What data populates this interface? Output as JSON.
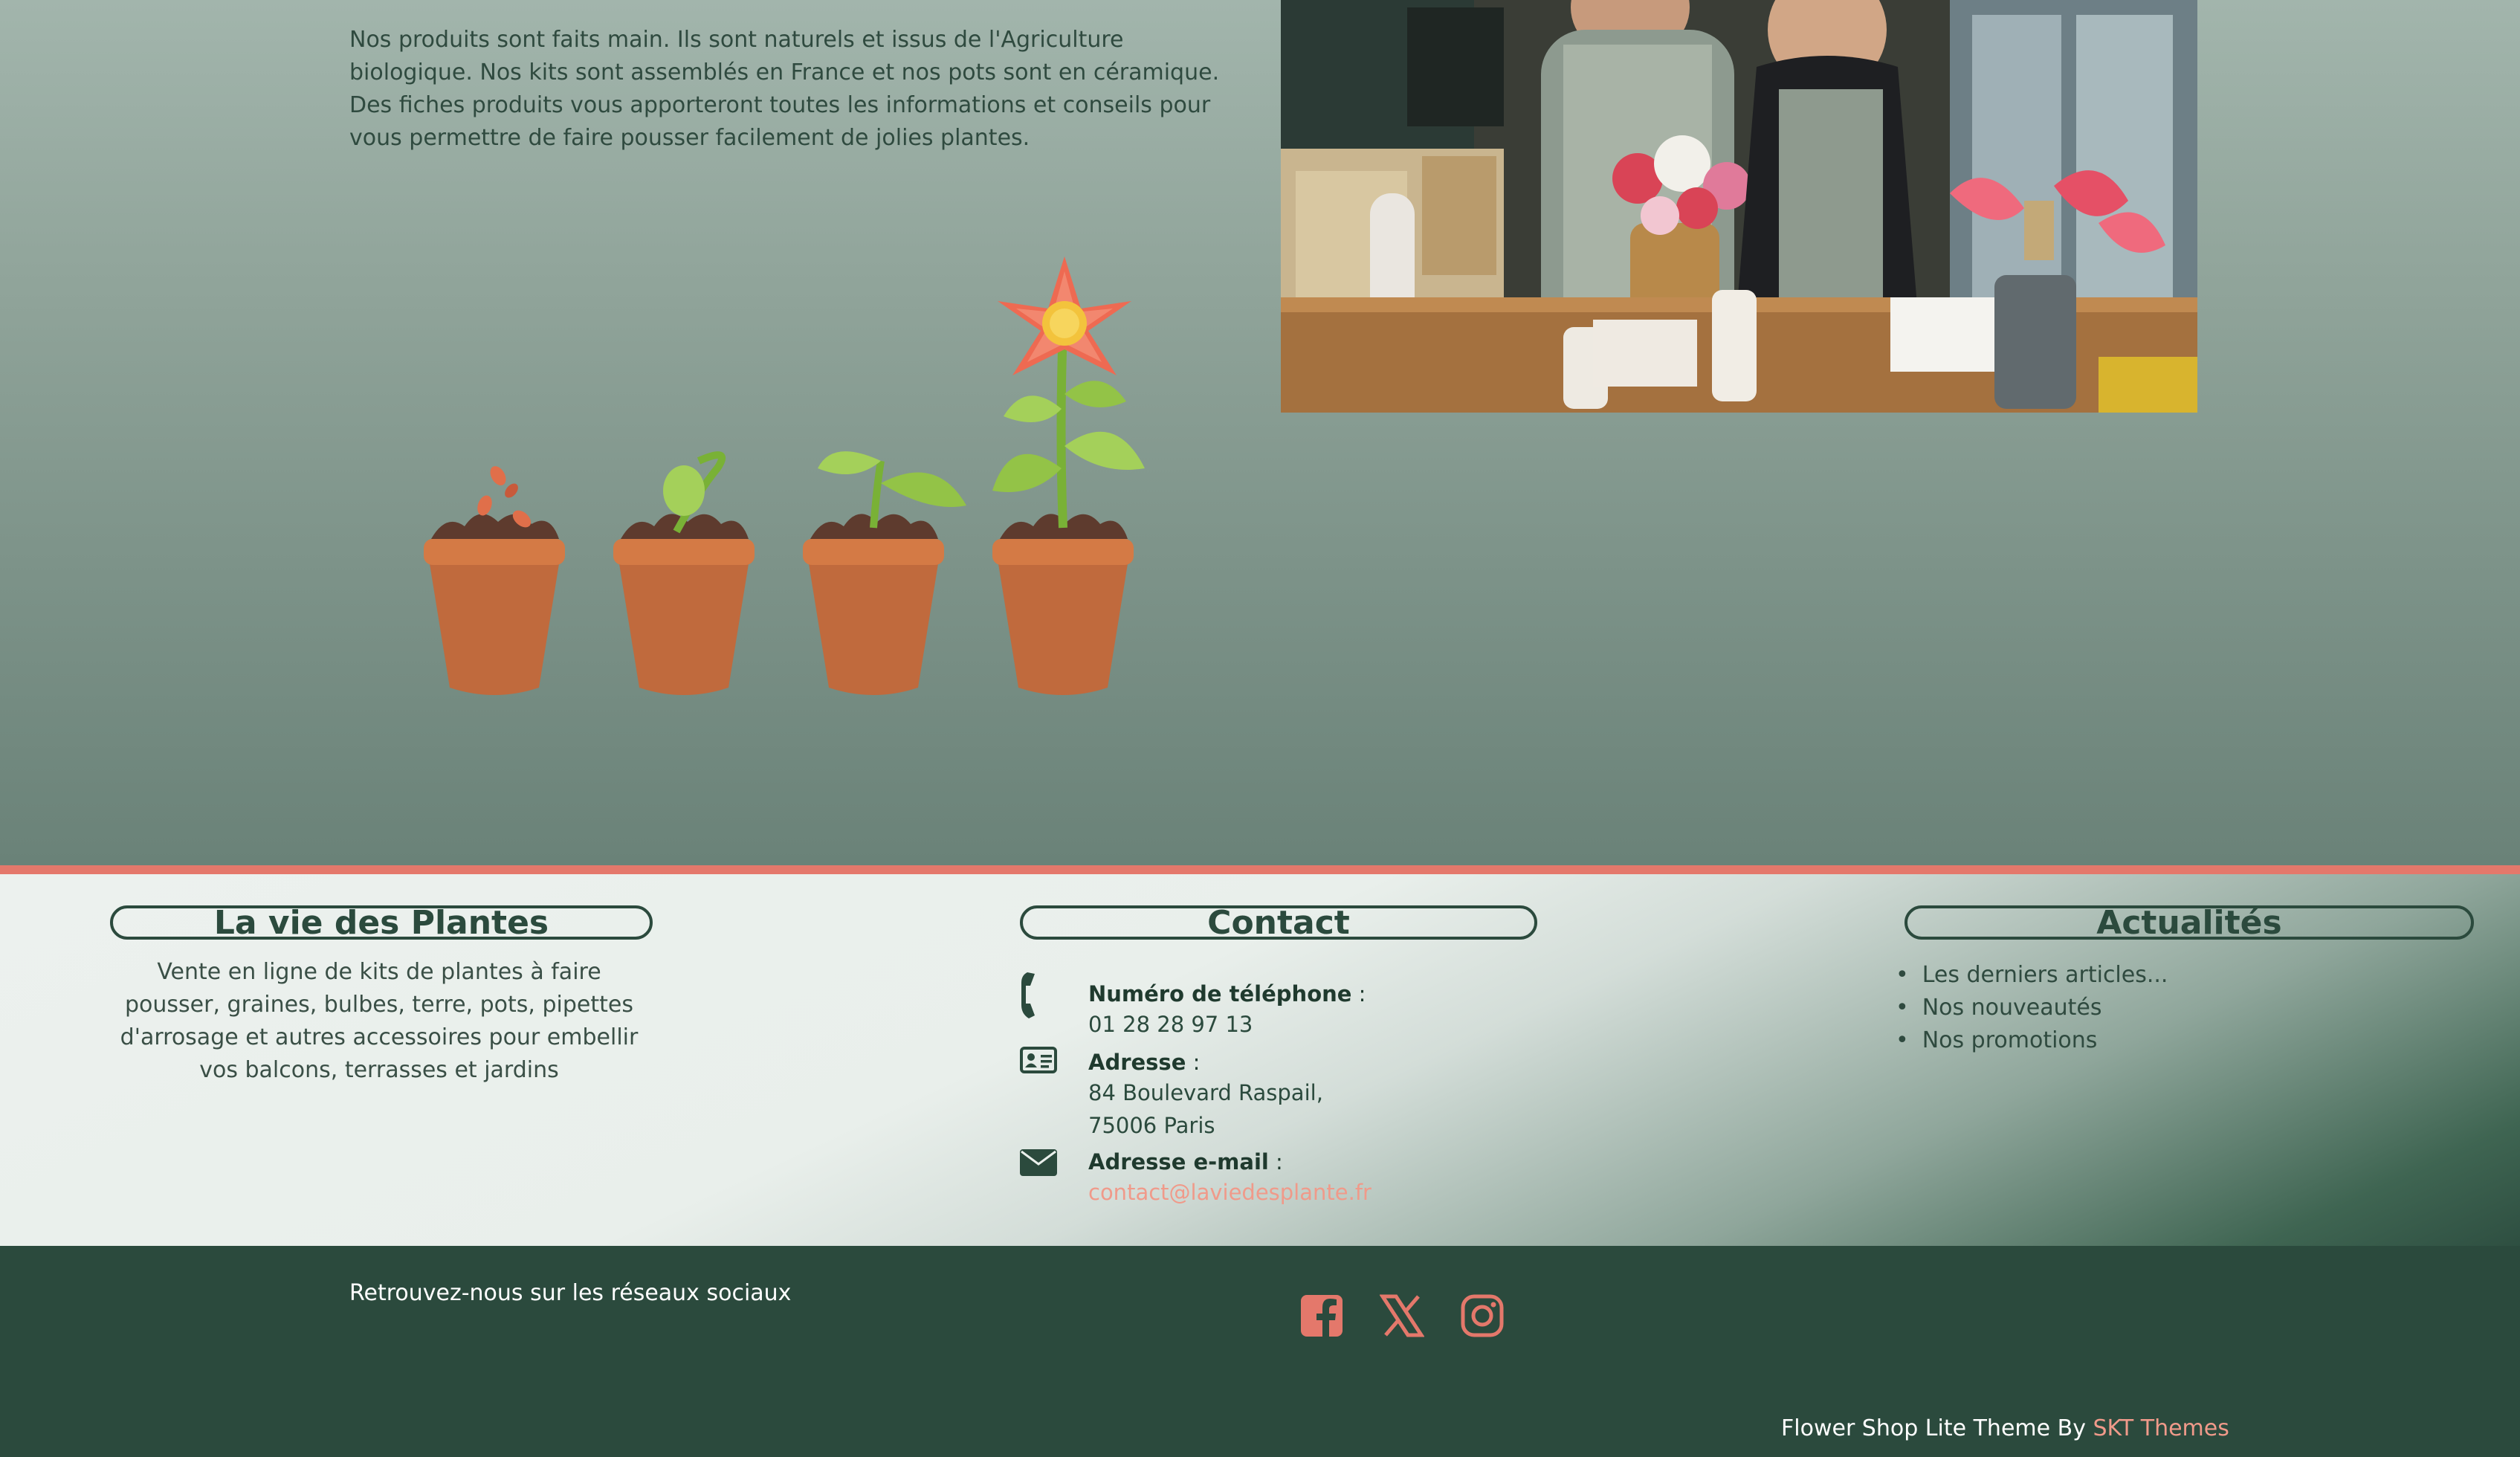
{
  "intro": {
    "paragraph1": "Nos produits sont faits main. Ils sont naturels et issus de l'Agriculture biologique. Nos kits sont assemblés en France et nos pots sont en céramique.",
    "paragraph2": "Des fiches produits vous apporteront toutes les informations et conseils pour vous permettre de faire pousser facilement de jolies plantes."
  },
  "footer": {
    "about": {
      "title": "La vie des Plantes",
      "text": "Vente en ligne de kits de plantes à faire pousser, graines, bulbes, terre, pots, pipettes d'arrosage et autres accessoires pour embellir vos balcons, terrasses et jardins"
    },
    "contact": {
      "title": "Contact",
      "phone_label": "Numéro de téléphone",
      "phone": "01 28 28 97 13",
      "address_label": "Adresse",
      "address_line1": "84 Boulevard Raspail,",
      "address_line2": "75006 Paris",
      "email_label": "Adresse e-mail",
      "email": "contact@laviedesplante.fr"
    },
    "news": {
      "title": "Actualités",
      "items": [
        "Les derniers articles...",
        "Nos nouveautés",
        "Nos promotions"
      ]
    }
  },
  "bottom": {
    "social_text": "Retrouvez-nous sur les réseaux sociaux",
    "social_icons": [
      "facebook-icon",
      "x-icon",
      "instagram-icon"
    ],
    "credits_prefix": "Flower Shop Lite Theme By",
    "credits_link": "SKT Themes"
  },
  "colors": {
    "accent": "#e4786b",
    "dark_green": "#2b4a3d",
    "link": "#f09a8a"
  }
}
